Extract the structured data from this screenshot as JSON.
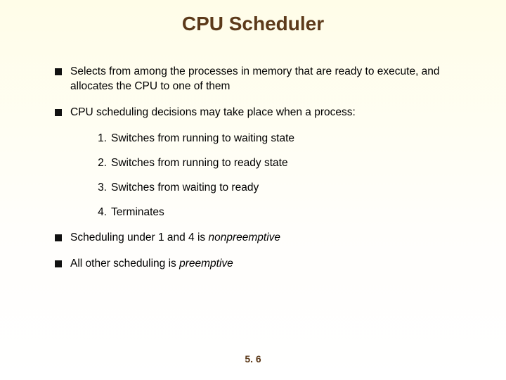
{
  "title": "CPU Scheduler",
  "bullets": {
    "b1": "Selects from among the processes in memory that are ready to execute, and allocates the CPU to one of them",
    "b2": "CPU scheduling decisions may take place when a process:",
    "b3_pre": "Scheduling under 1 and 4 is ",
    "b3_em": "nonpreemptive",
    "b4_pre": "All other scheduling is ",
    "b4_em": "preemptive"
  },
  "numbered": {
    "n1_num": "1.",
    "n1": "Switches from running to waiting state",
    "n2_num": "2.",
    "n2": "Switches from running to ready state",
    "n3_num": "3.",
    "n3": "Switches from waiting to ready",
    "n4_num": "4.",
    "n4": "Terminates"
  },
  "pagenum": "5. 6"
}
